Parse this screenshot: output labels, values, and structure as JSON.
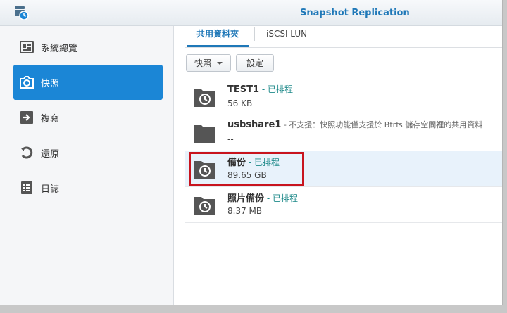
{
  "app": {
    "title": "Snapshot Replication"
  },
  "sidebar": {
    "items": [
      {
        "label": "系統總覽",
        "icon": "overview-icon",
        "active": false
      },
      {
        "label": "快照",
        "icon": "camera-icon",
        "active": true
      },
      {
        "label": "複寫",
        "icon": "replication-icon",
        "active": false
      },
      {
        "label": "還原",
        "icon": "restore-icon",
        "active": false
      },
      {
        "label": "日誌",
        "icon": "log-icon",
        "active": false
      }
    ]
  },
  "tabs": [
    {
      "label": "共用資料夾",
      "active": true
    },
    {
      "label": "iSCSI LUN",
      "active": false
    }
  ],
  "toolbar": {
    "snapshot_label": "快照",
    "settings_label": "設定"
  },
  "shares": [
    {
      "name": "TEST1",
      "status": " - 已排程",
      "size": "56 KB",
      "icon": "scheduled-folder-icon"
    },
    {
      "name": "usbshare1",
      "status": " - 不支援：快照功能僅支援於 Btrfs 儲存空間裡的共用資料",
      "size": "--",
      "icon": "folder-icon"
    },
    {
      "name": "備份",
      "status": " - 已排程",
      "size": "89.65 GB",
      "icon": "scheduled-folder-icon"
    },
    {
      "name": "照片備份",
      "status": " - 已排程",
      "size": "8.37 MB",
      "icon": "scheduled-folder-icon"
    }
  ],
  "colors": {
    "accent": "#1b86d6",
    "title": "#1f78b8",
    "highlight": "#c8141e"
  }
}
